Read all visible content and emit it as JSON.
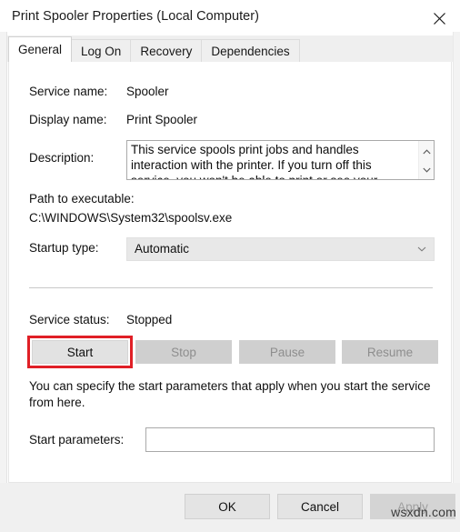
{
  "window": {
    "title": "Print Spooler Properties (Local Computer)",
    "close_icon": "close-icon"
  },
  "tabs": [
    {
      "label": "General",
      "active": true
    },
    {
      "label": "Log On",
      "active": false
    },
    {
      "label": "Recovery",
      "active": false
    },
    {
      "label": "Dependencies",
      "active": false
    }
  ],
  "general": {
    "service_name_label": "Service name:",
    "service_name_value": "Spooler",
    "display_name_label": "Display name:",
    "display_name_value": "Print Spooler",
    "description_label": "Description:",
    "description_value": "This service spools print jobs and handles interaction with the printer.  If you turn off this service, you won't be able to print or see your printers.",
    "scroll_up_icon": "chevron-up-icon",
    "scroll_down_icon": "chevron-down-icon",
    "path_label": "Path to executable:",
    "path_value": "C:\\WINDOWS\\System32\\spoolsv.exe",
    "startup_type_label": "Startup type:",
    "startup_type_value": "Automatic",
    "startup_type_arrow_icon": "chevron-down-icon",
    "service_status_label": "Service status:",
    "service_status_value": "Stopped",
    "buttons": [
      {
        "label": "Start",
        "enabled": true,
        "highlighted": true
      },
      {
        "label": "Stop",
        "enabled": false,
        "highlighted": false
      },
      {
        "label": "Pause",
        "enabled": false,
        "highlighted": false
      },
      {
        "label": "Resume",
        "enabled": false,
        "highlighted": false
      }
    ],
    "start_params_hint": "You can specify the start parameters that apply when you start the service from here.",
    "start_params_label": "Start parameters:",
    "start_params_value": "",
    "start_params_placeholder": ""
  },
  "footer": {
    "ok_label": "OK",
    "cancel_label": "Cancel",
    "apply_label": "Apply",
    "apply_enabled": false
  },
  "watermark": "wsxdn.com",
  "colors": {
    "highlight": "#e01f26",
    "window_bg": "#ffffff",
    "footer_bg": "#f0f0f0",
    "tabstrip_bg": "#efefef"
  }
}
